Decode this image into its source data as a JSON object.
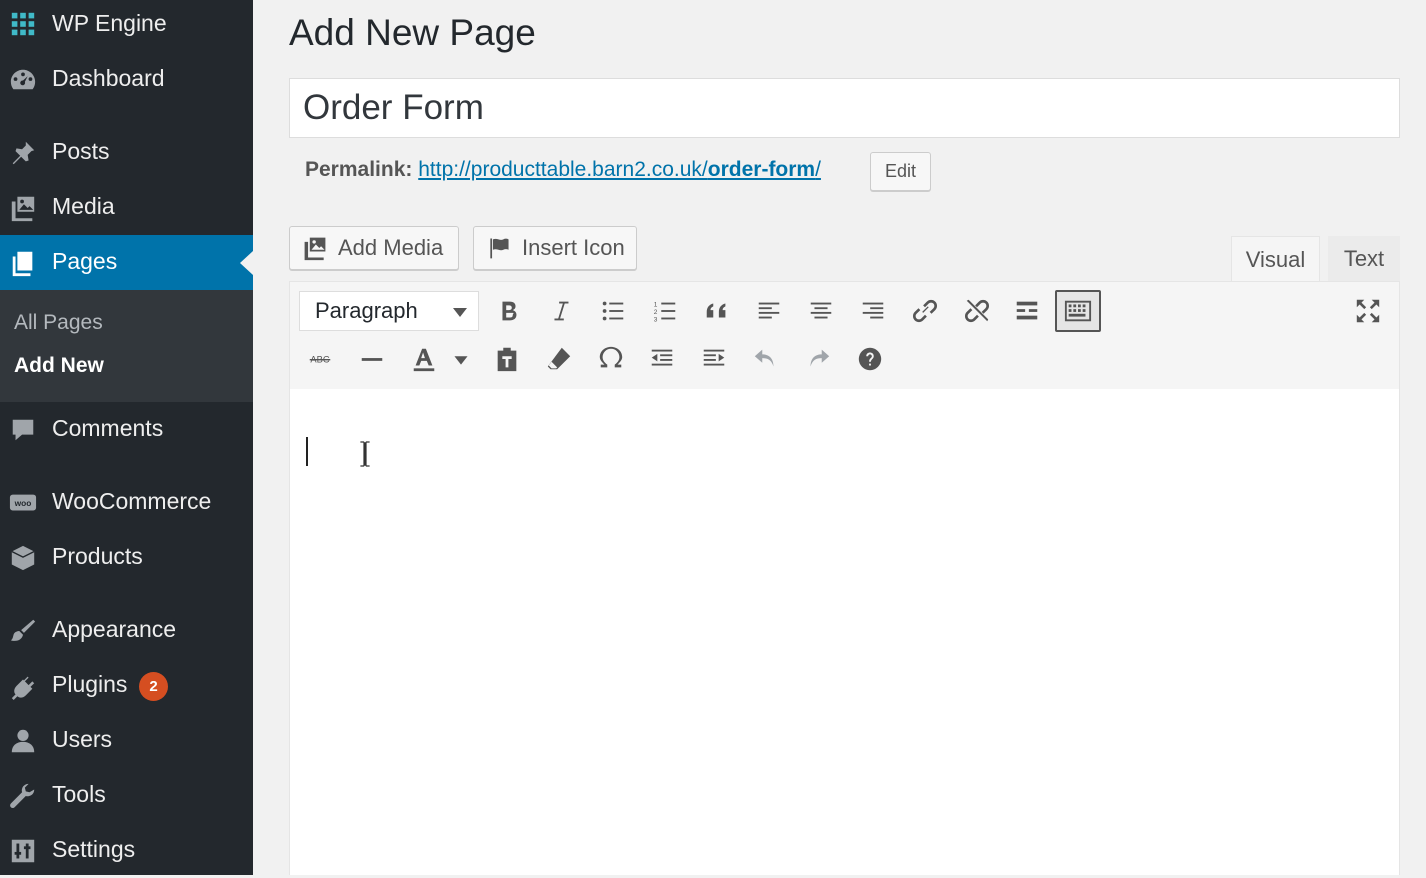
{
  "sidebar": {
    "header": "WP Engine",
    "items": [
      {
        "label": "Dashboard",
        "icon": "dashboard-icon"
      },
      {
        "label": "Posts",
        "icon": "pin-icon"
      },
      {
        "label": "Media",
        "icon": "media-icon"
      },
      {
        "label": "Pages",
        "icon": "pages-icon",
        "active": true
      },
      {
        "label": "Comments",
        "icon": "comment-icon"
      },
      {
        "label": "WooCommerce",
        "icon": "woocommerce-icon"
      },
      {
        "label": "Products",
        "icon": "box-icon"
      },
      {
        "label": "Appearance",
        "icon": "paintbrush-icon"
      },
      {
        "label": "Plugins",
        "icon": "plugin-icon",
        "badge": "2"
      },
      {
        "label": "Users",
        "icon": "user-icon"
      },
      {
        "label": "Tools",
        "icon": "wrench-icon"
      },
      {
        "label": "Settings",
        "icon": "settings-icon"
      }
    ],
    "submenu": {
      "all_pages": "All Pages",
      "add_new": "Add New"
    }
  },
  "main": {
    "page_title": "Add New Page",
    "title_value": "Order Form",
    "permalink": {
      "label": "Permalink:",
      "url_base": "http://producttable.barn2.co.uk/",
      "slug": "order-form",
      "trailing": "/",
      "edit_label": "Edit"
    },
    "media_buttons": {
      "add_media": "Add Media",
      "insert_icon": "Insert Icon"
    },
    "editor_tabs": {
      "visual": "Visual",
      "text": "Text"
    },
    "toolbar": {
      "format_select": "Paragraph",
      "strikethrough_text": "ABC"
    }
  },
  "colors": {
    "sidebar_bg": "#23282d",
    "submenu_bg": "#32373c",
    "active_bg": "#0073aa",
    "badge_bg": "#d54e21",
    "link": "#0073aa",
    "page_bg": "#f1f1f1"
  }
}
